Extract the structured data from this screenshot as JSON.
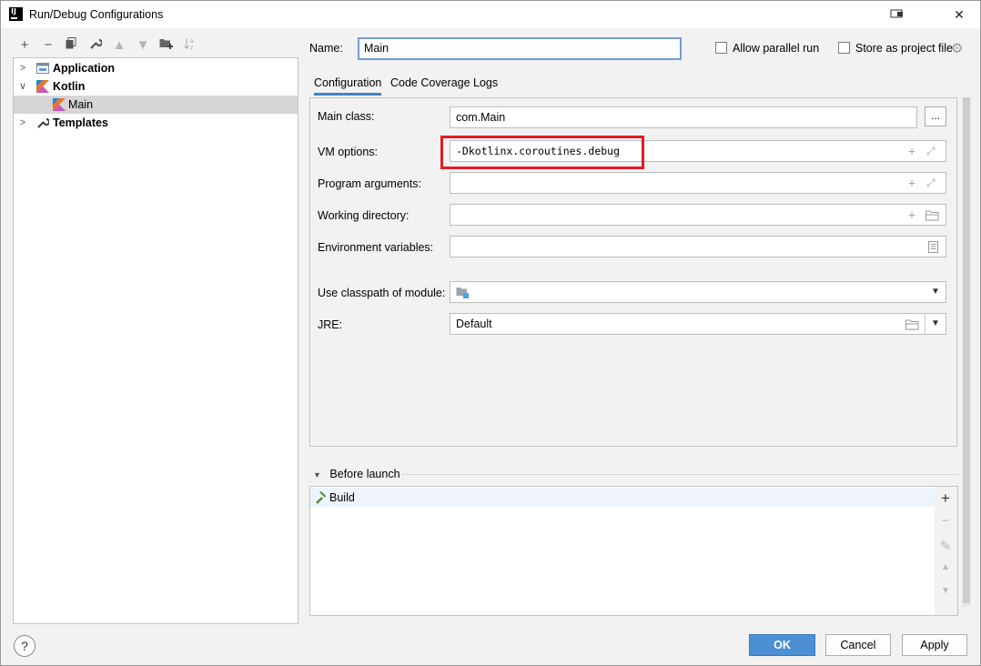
{
  "window": {
    "title": "Run/Debug Configurations",
    "app_icon_text": "IJ"
  },
  "left_toolbar": {
    "icons": [
      "add-icon",
      "remove-icon",
      "copy-icon",
      "wrench-icon",
      "move-up-icon",
      "move-down-icon",
      "new-folder-icon",
      "sort-icon"
    ]
  },
  "tree": {
    "items": [
      {
        "label": "Application",
        "expanded": false
      },
      {
        "label": "Kotlin",
        "expanded": true
      },
      {
        "label": "Main",
        "selected": true
      },
      {
        "label": "Templates",
        "expanded": false
      }
    ]
  },
  "header": {
    "name_label": "Name:",
    "name_value": "Main",
    "allow_parallel_run": {
      "label": "Allow parallel run",
      "checked": false
    },
    "store_as_project_file": {
      "label": "Store as project file",
      "checked": false
    }
  },
  "tabs": [
    {
      "label": "Configuration",
      "active": true
    },
    {
      "label": "Code Coverage",
      "active": false
    },
    {
      "label": "Logs",
      "active": false
    }
  ],
  "form": {
    "main_class": {
      "label": "Main class:",
      "value": "com.Main",
      "browse_label": "..."
    },
    "vm_options": {
      "label": "VM options:",
      "value": "-Dkotlinx.coroutines.debug"
    },
    "program_arguments": {
      "label": "Program arguments:",
      "value": ""
    },
    "working_directory": {
      "label": "Working directory:",
      "value": ""
    },
    "environment_variables": {
      "label": "Environment variables:",
      "value": ""
    },
    "classpath_module": {
      "label": "Use classpath of module:",
      "value": ""
    },
    "jre": {
      "label": "JRE:",
      "value": "Default"
    }
  },
  "before_launch": {
    "title": "Before launch",
    "items": [
      "Build"
    ]
  },
  "buttons": {
    "ok": "OK",
    "cancel": "Cancel",
    "apply": "Apply",
    "help": "?"
  },
  "colors": {
    "accent": "#4d8fd4",
    "highlight_box": "#e31c24",
    "tab_underline": "#4083c9"
  }
}
